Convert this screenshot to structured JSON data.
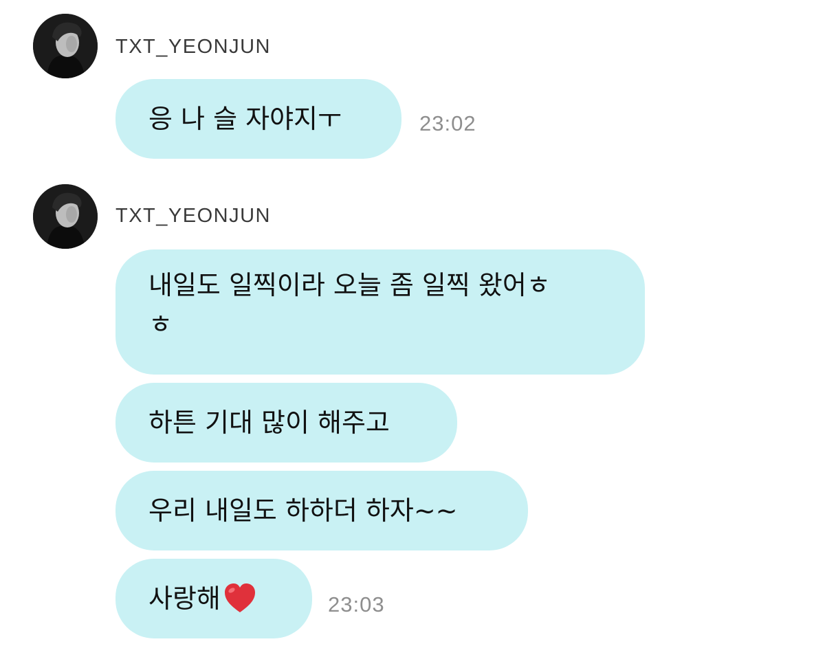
{
  "chat": {
    "groups": [
      {
        "sender": "TXT_YEONJUN",
        "messages": [
          {
            "text": "응 나 슬 자야지ㅜ",
            "time": "23:02"
          }
        ]
      },
      {
        "sender": "TXT_YEONJUN",
        "messages": [
          {
            "text": "내일도 일찍이라 오늘 좀 일찍 왔어ㅎ\nㅎ",
            "time": ""
          },
          {
            "text": "하튼 기대 많이 해주고",
            "time": ""
          },
          {
            "text": "우리 내일도 하하더 하자~~",
            "time": ""
          },
          {
            "text": "사랑해",
            "emoji": "red-heart",
            "time": "23:03"
          }
        ]
      }
    ]
  },
  "colors": {
    "bubble": "#c9f1f4",
    "timestamp": "#8e8e8e",
    "sender": "#3a3a3a",
    "heart": "#e0313b"
  }
}
